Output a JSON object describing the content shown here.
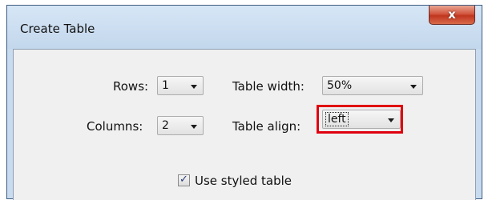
{
  "window": {
    "title": "Create Table",
    "close_label": "x"
  },
  "form": {
    "rows": {
      "label": "Rows:",
      "value": "1"
    },
    "columns": {
      "label": "Columns:",
      "value": "2"
    },
    "table_width": {
      "label": "Table width:",
      "value": "50%"
    },
    "table_align": {
      "label": "Table align:",
      "value": "left",
      "highlighted": true
    },
    "use_styled_table": {
      "label": "Use styled table",
      "checked": true
    }
  },
  "colors": {
    "highlight_box": "#e0000f",
    "titlebar": "#c9dcef"
  }
}
